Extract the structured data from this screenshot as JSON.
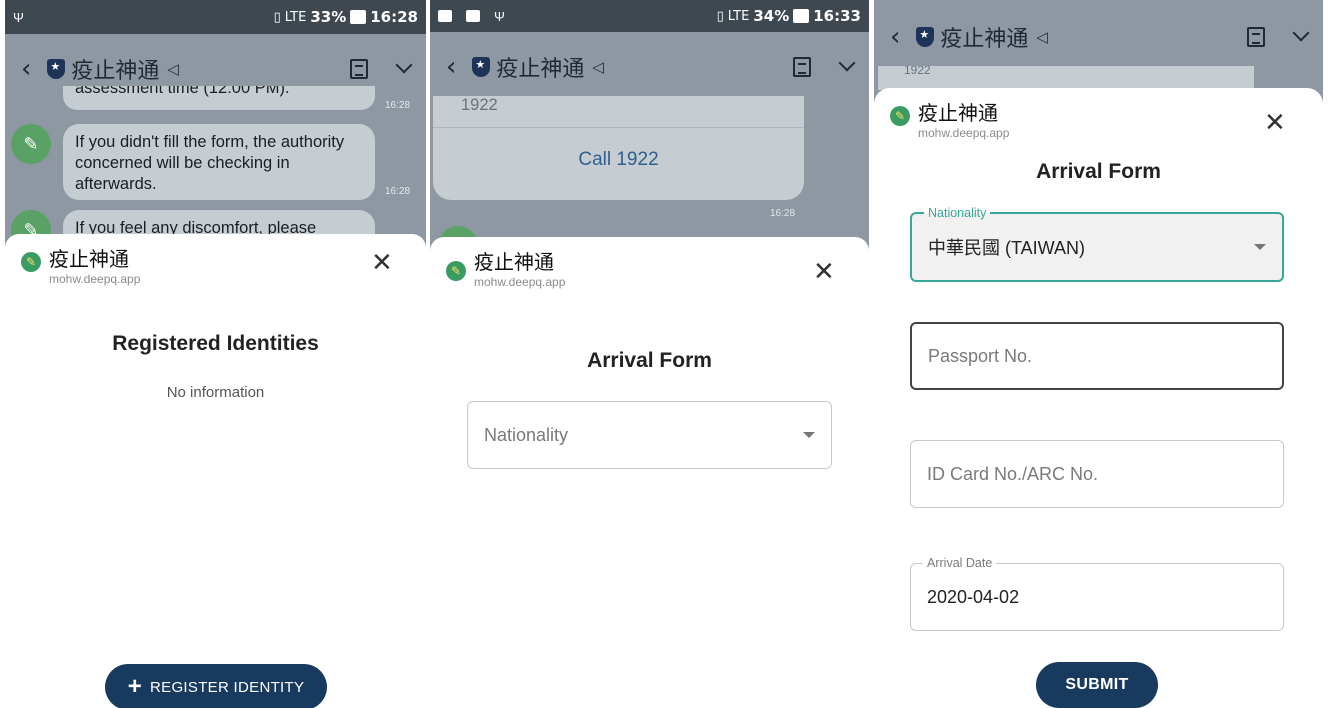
{
  "panels": [
    {
      "status": {
        "left_icons": [
          "usb-icon"
        ],
        "vibrate": "▯",
        "network": "LTE",
        "battery": "33%",
        "time": "16:28"
      },
      "app_bar": {
        "title": "疫止神通"
      },
      "chat": {
        "msg_partial": "assessment time (12:00 PM).",
        "msg_1": "If you didn't fill the form, the authority concerned will be checking in afterwards.",
        "msg_2": "If you feel any discomfort, please",
        "time_1": "16:28",
        "time_2": "16:28"
      },
      "sheet": {
        "app_name": "疫止神通",
        "url": "mohw.deepq.app",
        "close": "✕",
        "heading": "Registered Identities",
        "empty": "No information",
        "button": "REGISTER IDENTITY",
        "button_icon": "+"
      }
    },
    {
      "status": {
        "left_icons": [
          "message-icon",
          "image-icon",
          "usb-icon"
        ],
        "vibrate": "▯",
        "network": "LTE",
        "battery": "34%",
        "time": "16:33"
      },
      "app_bar": {
        "title": "疫止神通"
      },
      "chat": {
        "msg_partial": "1922",
        "call_button": "Call 1922",
        "time_1": "16:28"
      },
      "sheet": {
        "app_name": "疫止神通",
        "url": "mohw.deepq.app",
        "close": "✕",
        "heading": "Arrival Form",
        "nationality_placeholder": "Nationality"
      }
    },
    {
      "app_bar": {
        "title": "疫止神通"
      },
      "chat": {
        "msg_partial": "1922"
      },
      "sheet": {
        "app_name": "疫止神通",
        "url": "mohw.deepq.app",
        "close": "✕",
        "heading": "Arrival Form",
        "nationality_label": "Nationality",
        "nationality_value": "中華民國 (TAIWAN)",
        "passport_placeholder": "Passport No.",
        "id_placeholder": "ID Card No./ARC No.",
        "arrival_label": "Arrival Date",
        "arrival_value": "2020-04-02",
        "submit": "SUBMIT"
      }
    }
  ],
  "colors": {
    "primary_button": "#173a5e",
    "focus_teal": "#39a899",
    "chat_bg": "#8e98a2",
    "statusbar": "#3e4850"
  }
}
